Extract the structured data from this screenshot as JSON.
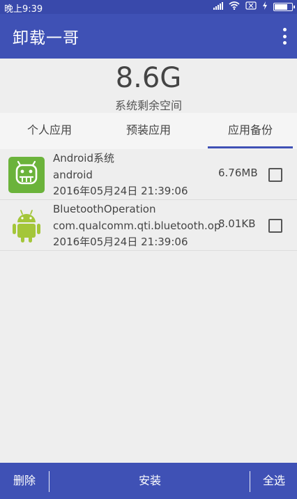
{
  "statusbar": {
    "time": "晚上9:39",
    "icons": [
      "signal-icon",
      "wifi-icon",
      "sim-off-icon",
      "charging-icon",
      "battery-icon"
    ]
  },
  "appbar": {
    "title": "卸载一哥",
    "menu_icon": "more-vert-icon"
  },
  "storage": {
    "size": "8.6G",
    "label": "系统剩余空间"
  },
  "tabs": {
    "items": [
      "个人应用",
      "预装应用",
      "应用备份"
    ],
    "active_index": 2
  },
  "list": {
    "items": [
      {
        "name": "Android系统",
        "package": "android",
        "date": "2016年05月24日 21:39:06",
        "size": "6.76MB",
        "checked": false,
        "icon": "android-system-icon"
      },
      {
        "name": "BluetoothOperation",
        "package": "com.qualcomm.qti.bluetooth.op",
        "date": "2016年05月24日 21:39:06",
        "size": "8.01KB",
        "checked": false,
        "icon": "android-robot-icon"
      }
    ]
  },
  "bottombar": {
    "delete_label": "删除",
    "install_label": "安装",
    "select_all_label": "全选"
  },
  "colors": {
    "primary": "#3f51b5",
    "statusbar": "#3949ab",
    "background": "#eeeeee",
    "icon_green": "#6bb33b"
  }
}
